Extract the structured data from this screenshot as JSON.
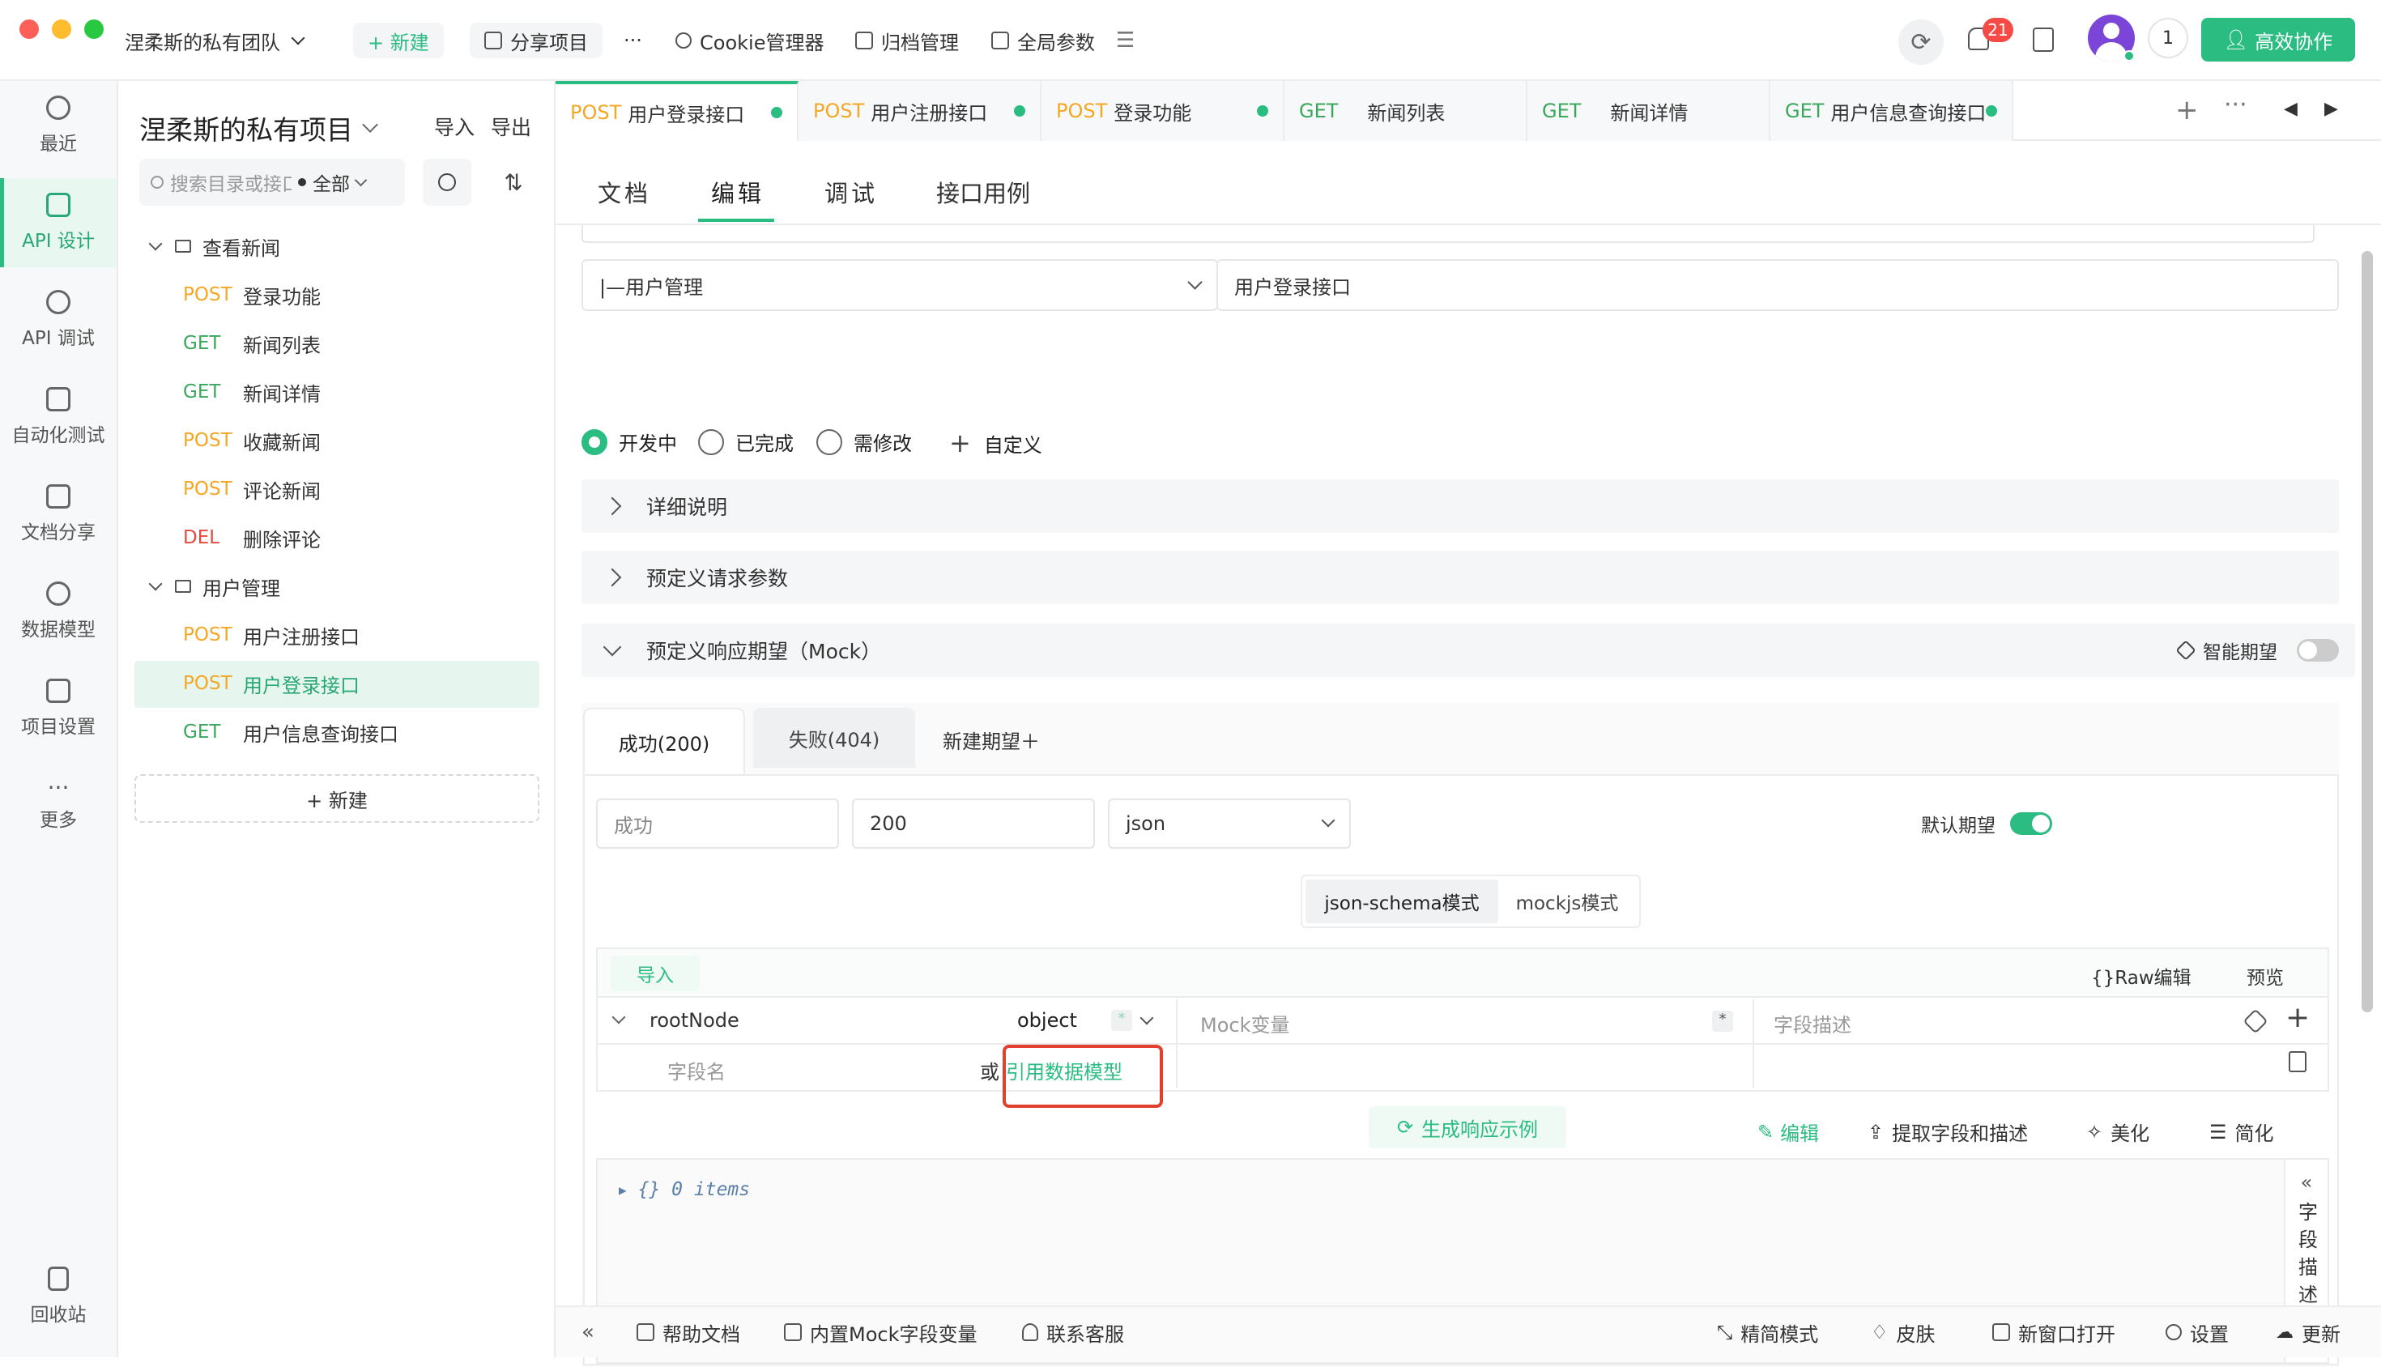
{
  "titlebar": {
    "team": "涅柔斯的私有团队",
    "new_label": "+ 新建",
    "share_label": "分享项目",
    "more_label": "···",
    "cookie_label": "Cookie管理器",
    "archive_label": "归档管理",
    "globals_label": "全局参数",
    "notif_count": "21",
    "online_count": "1",
    "collab_label": "高效协作"
  },
  "rail": {
    "items": [
      {
        "label": "最近"
      },
      {
        "label": "API 设计"
      },
      {
        "label": "API 调试"
      },
      {
        "label": "自动化测试"
      },
      {
        "label": "文档分享"
      },
      {
        "label": "数据模型"
      },
      {
        "label": "项目设置"
      },
      {
        "label": "更多"
      }
    ],
    "trash_label": "回收站"
  },
  "tree": {
    "project": "涅柔斯的私有项目",
    "import": "导入",
    "export": "导出",
    "search_placeholder": "搜索目录或接口",
    "filter": "全部",
    "folders": [
      {
        "name": "查看新闻"
      },
      {
        "name": "用户管理"
      }
    ],
    "items": [
      {
        "method": "POST",
        "name": "登录功能"
      },
      {
        "method": "GET",
        "name": "新闻列表"
      },
      {
        "method": "GET",
        "name": "新闻详情"
      },
      {
        "method": "POST",
        "name": "收藏新闻"
      },
      {
        "method": "POST",
        "name": "评论新闻"
      },
      {
        "method": "DEL",
        "name": "删除评论"
      },
      {
        "method": "POST",
        "name": "用户注册接口"
      },
      {
        "method": "POST",
        "name": "用户登录接口"
      },
      {
        "method": "GET",
        "name": "用户信息查询接口"
      }
    ],
    "new_label": "+ 新建"
  },
  "tabs": [
    {
      "method": "POST",
      "name": "用户登录接口"
    },
    {
      "method": "POST",
      "name": "用户注册接口"
    },
    {
      "method": "POST",
      "name": "登录功能"
    },
    {
      "method": "GET",
      "name": "新闻列表"
    },
    {
      "method": "GET",
      "name": "新闻详情"
    },
    {
      "method": "GET",
      "name": "用户信息查询接口"
    }
  ],
  "subtabs": [
    "文档",
    "编辑",
    "调试",
    "接口用例"
  ],
  "form": {
    "folder": "|—用户管理",
    "name": "用户登录接口",
    "status": [
      "开发中",
      "已完成",
      "需修改"
    ],
    "custom": "自定义"
  },
  "sections": {
    "detail": "详细说明",
    "predef_req": "预定义请求参数",
    "predef_resp": "预定义响应期望（Mock）",
    "smart": "智能期望"
  },
  "mock": {
    "tabs": [
      "成功(200)",
      "失败(404)"
    ],
    "new_tab": "新建期望＋",
    "name_value": "成功",
    "code_value": "200",
    "format_value": "json",
    "default_label": "默认期望",
    "mode1": "json-schema模式",
    "mode2": "mockjs模式",
    "import": "导入",
    "raw": "{}Raw编辑",
    "preview": "预览",
    "root": "rootNode",
    "type": "object",
    "mock_placeholder": "Mock变量",
    "desc_placeholder": "字段描述",
    "field_placeholder": "字段名",
    "or": "或",
    "ref_model": "引用数据模型",
    "gen": "生成响应示例",
    "edit": "编辑",
    "extract": "提取字段和描述",
    "beautify": "美化",
    "simplify": "简化",
    "json_preview": "{}  0 items",
    "side_label": "字段描述"
  },
  "footer": {
    "help": "帮助文档",
    "mockvars": "内置Mock字段变量",
    "support": "联系客服",
    "simple": "精简模式",
    "skin": "皮肤",
    "newwin": "新窗口打开",
    "settings": "设置",
    "update": "更新"
  },
  "colors": {
    "accent": "#2bbc82",
    "post": "#f5a623",
    "get": "#3aa85c",
    "del": "#e5483f",
    "highlight": "#e0412f"
  }
}
